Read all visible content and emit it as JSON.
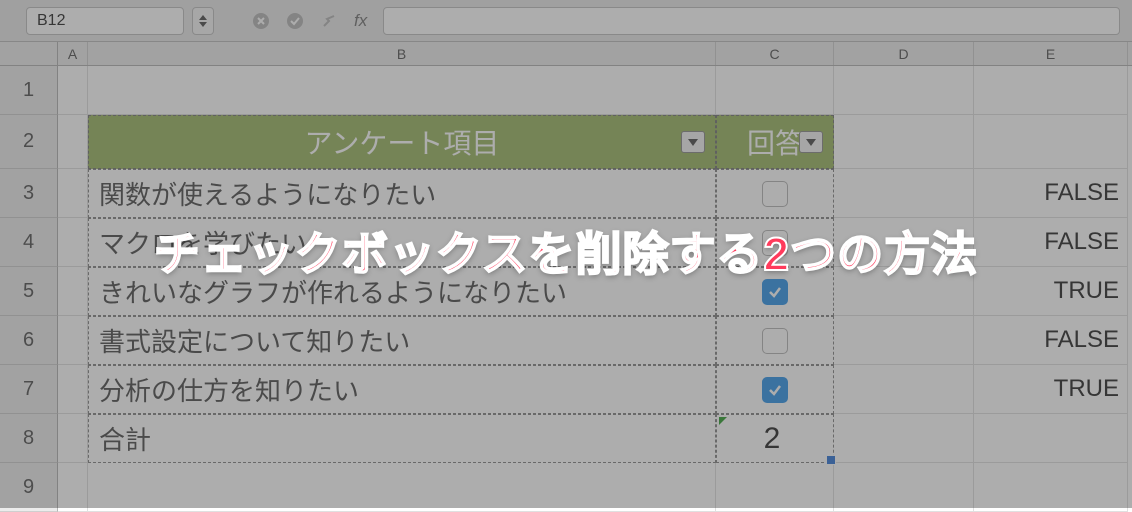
{
  "formula_bar": {
    "name_box": "B12",
    "fx_label": "fx"
  },
  "columns": [
    "A",
    "B",
    "C",
    "D",
    "E"
  ],
  "row_numbers": [
    "1",
    "2",
    "3",
    "4",
    "5",
    "6",
    "7",
    "8",
    "9"
  ],
  "table": {
    "headers": {
      "b": "アンケート項目",
      "c": "回答"
    },
    "rows": [
      {
        "label": "関数が使えるようになりたい",
        "checked": false,
        "result": "FALSE"
      },
      {
        "label": "マクロを学びたい",
        "checked": false,
        "result": "FALSE"
      },
      {
        "label": "きれいなグラフが作れるようになりたい",
        "checked": true,
        "result": "TRUE"
      },
      {
        "label": "書式設定について知りたい",
        "checked": false,
        "result": "FALSE"
      },
      {
        "label": "分析の仕方を知りたい",
        "checked": true,
        "result": "TRUE"
      }
    ],
    "total_label": "合計",
    "total_value": "2"
  },
  "overlay_title": "チェックボックスを削除する2つの方法"
}
